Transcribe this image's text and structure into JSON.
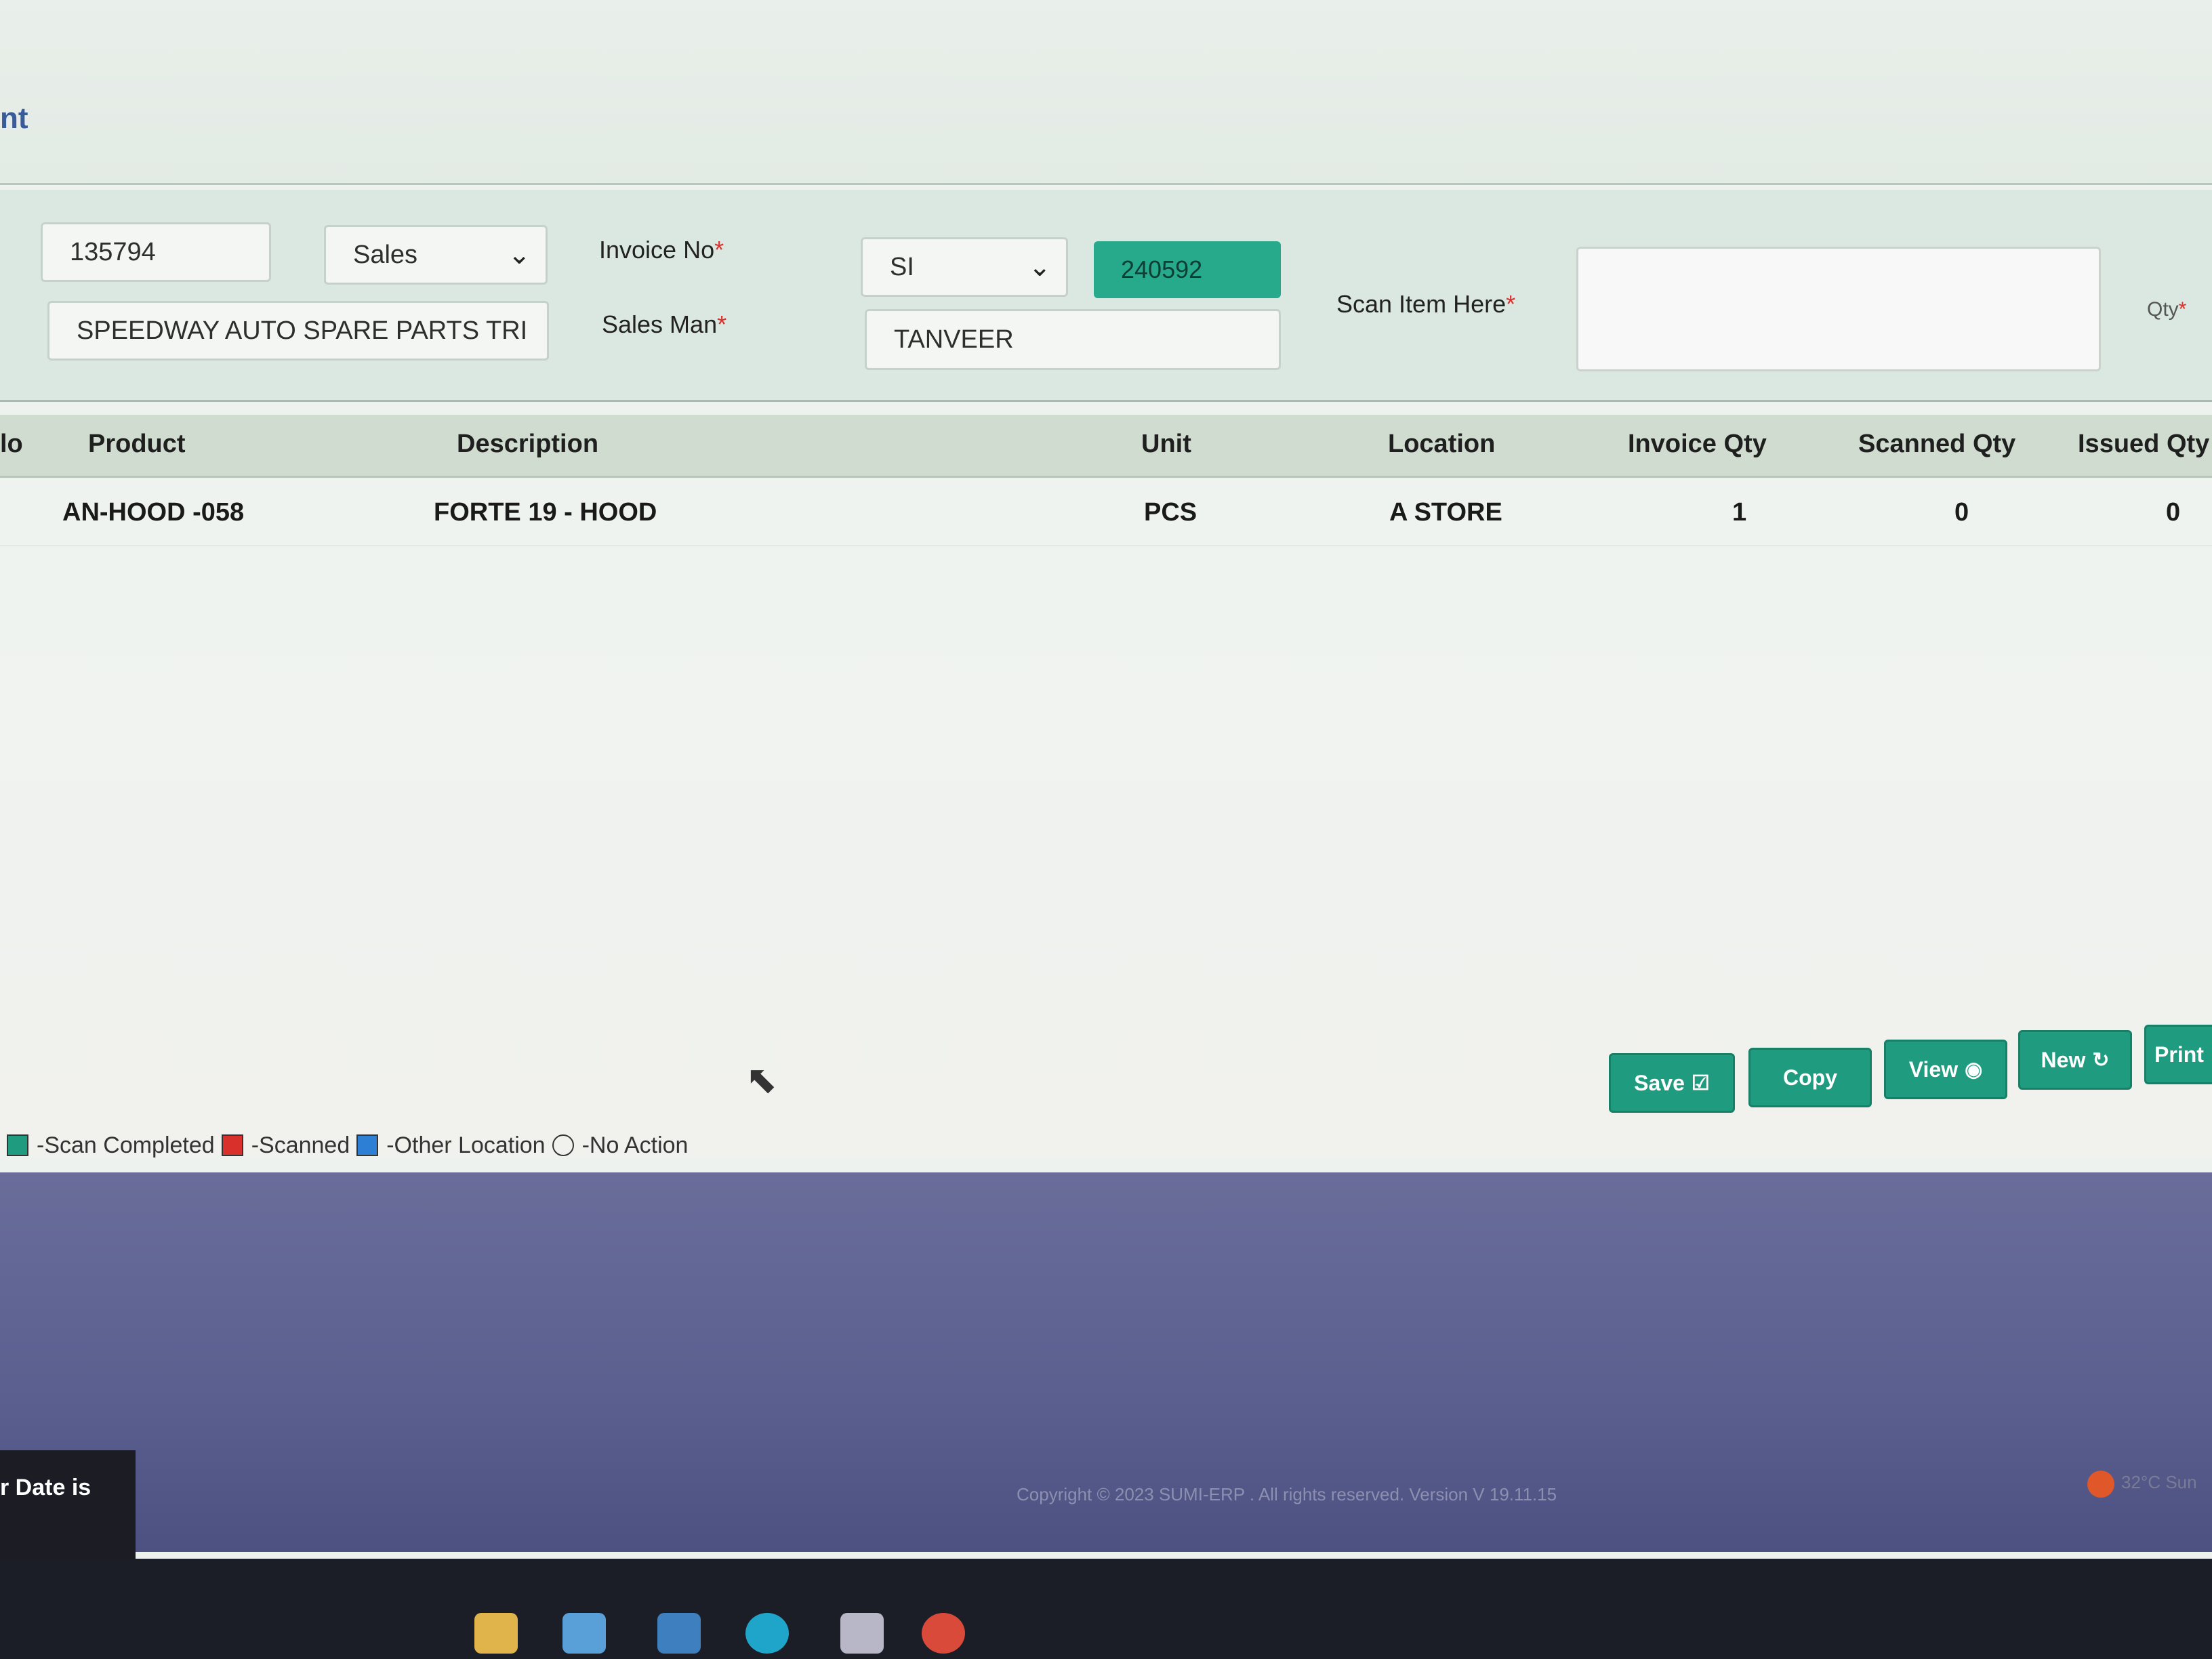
{
  "page": {
    "title_fragment": "nt"
  },
  "form": {
    "doc_id": "135794",
    "doc_type": "Sales",
    "customer": "SPEEDWAY AUTO SPARE PARTS TRI",
    "invoice_label": "Invoice No",
    "invoice_prefix": "SI",
    "invoice_number": "240592",
    "salesman_label": "Sales Man",
    "salesman": "TANVEER",
    "scan_label": "Scan Item Here",
    "scan_value": "",
    "qty_label": "Qty",
    "required_mark": "*"
  },
  "table": {
    "columns": [
      "lo",
      "Product",
      "Description",
      "Unit",
      "Location",
      "Invoice Qty",
      "Scanned Qty",
      "Issued Qty"
    ],
    "rows": [
      {
        "no": "",
        "product": "AN-HOOD -058",
        "description": "FORTE 19 - HOOD",
        "unit": "PCS",
        "location": "A STORE",
        "invoice_qty": "1",
        "scanned_qty": "0",
        "issued_qty": "0"
      }
    ]
  },
  "buttons": {
    "save": "Save",
    "copy": "Copy",
    "view": "View",
    "new": "New",
    "print": "Print"
  },
  "legend": {
    "scan_completed": "-Scan Completed",
    "scanned": "-Scanned",
    "other_location": "-Other Location",
    "no_action": "-No Action",
    "colors": {
      "scan_completed": "#1f9c7f",
      "scanned": "#d9302c",
      "other_location": "#2d7fd6"
    }
  },
  "toast": {
    "text": "r Date is"
  },
  "footer": {
    "copyright": "Copyright © 2023 SUMI-ERP . All rights reserved. Version V 19.11.15"
  },
  "taskbar": {
    "weather": "32°C Sun"
  }
}
